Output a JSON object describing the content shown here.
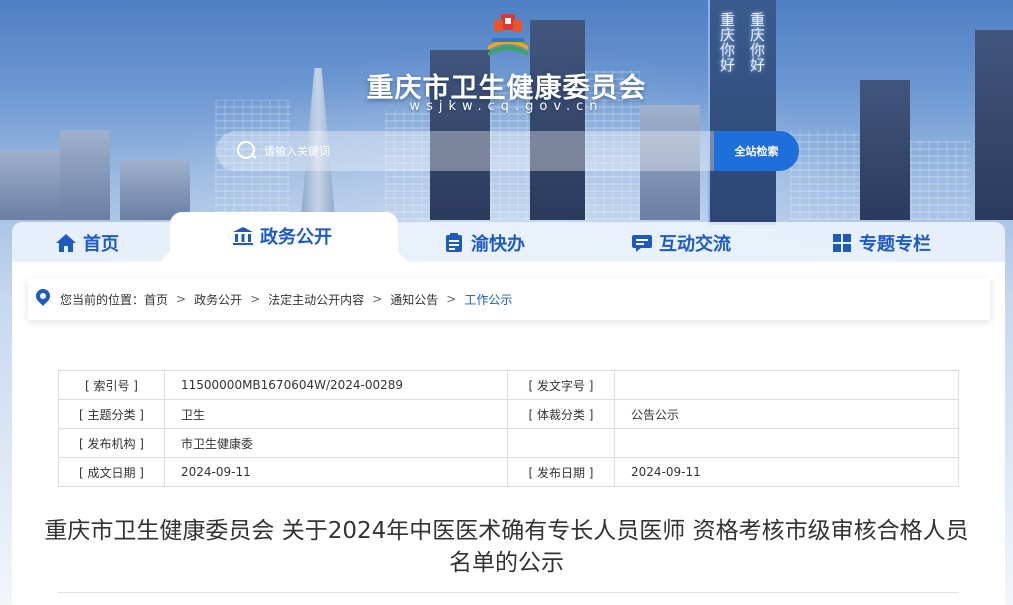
{
  "header": {
    "site_title": "重庆市卫生健康委员会",
    "site_domain": "wsjkw.cq.gov.cn",
    "led_left": "重庆你好",
    "led_right": "重庆你好",
    "search": {
      "placeholder": "请输入关键词",
      "button_label": "全站检索"
    }
  },
  "nav": {
    "items": [
      {
        "label": "首页",
        "icon": "home-icon",
        "active": false
      },
      {
        "label": "政务公开",
        "icon": "government-building-icon",
        "active": true
      },
      {
        "label": "渝快办",
        "icon": "clipboard-icon",
        "active": false
      },
      {
        "label": "互动交流",
        "icon": "chat-bubble-icon",
        "active": false
      },
      {
        "label": "专题专栏",
        "icon": "grid-icon",
        "active": false
      }
    ]
  },
  "breadcrumb": {
    "prefix": "您当前的位置：",
    "items": [
      "首页",
      "政务公开",
      "法定主动公开内容",
      "通知公告",
      "工作公示"
    ],
    "separator": ">"
  },
  "meta": {
    "rows": [
      {
        "label1": "[ 索引号 ]",
        "value1": "11500000MB1670604W/2024-00289",
        "label2": "[ 发文字号 ]",
        "value2": ""
      },
      {
        "label1": "[ 主题分类 ]",
        "value1": "卫生",
        "label2": "[ 体裁分类 ]",
        "value2": "公告公示"
      },
      {
        "label1": "[ 发布机构 ]",
        "value1": "市卫生健康委",
        "label2": "",
        "value2": ""
      },
      {
        "label1": "[ 成文日期 ]",
        "value1": "2024-09-11",
        "label2": "[ 发布日期 ]",
        "value2": "2024-09-11"
      }
    ]
  },
  "article": {
    "title": "重庆市卫生健康委员会 关于2024年中医医术确有专长人员医师 资格考核市级审核合格人员名单的公示"
  },
  "colors": {
    "primary": "#1d5bbf",
    "search_button": "#1e6fd9",
    "text": "#333333",
    "border": "#dddddd"
  }
}
